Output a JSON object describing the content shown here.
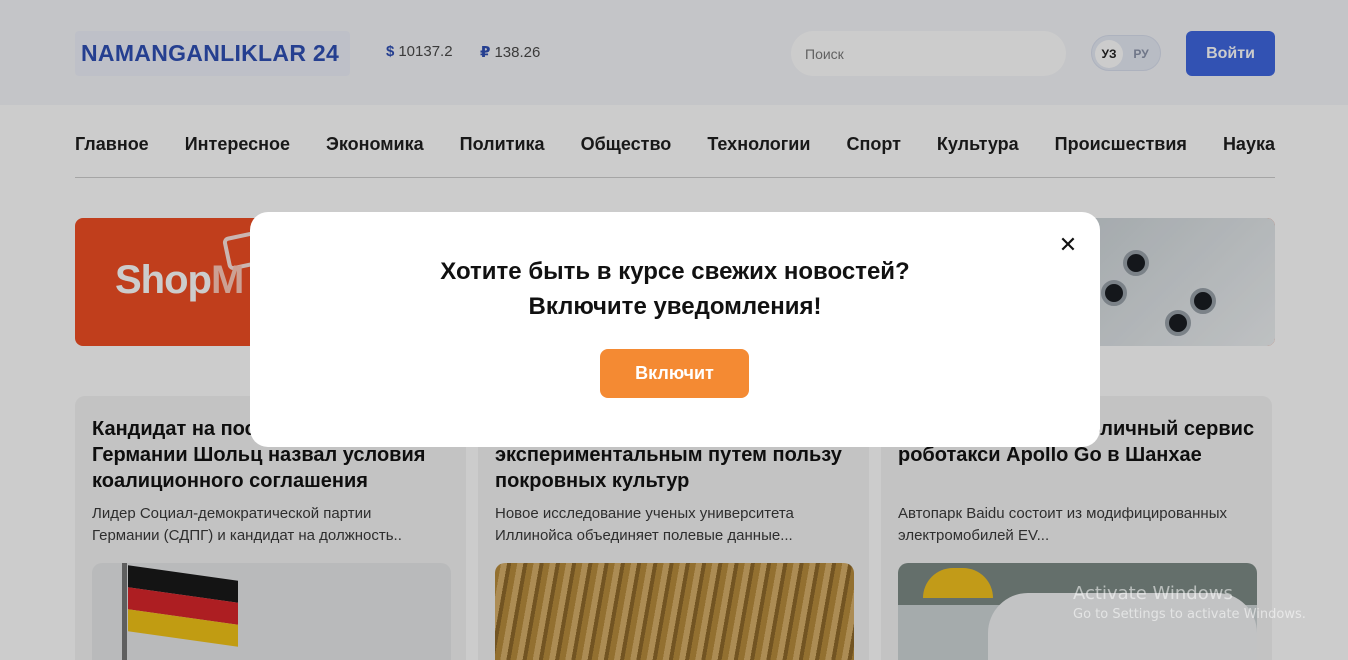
{
  "header": {
    "logo": "NAMANGANLIKLAR 24",
    "rates": [
      {
        "symbol": "$",
        "value": "10137.2"
      },
      {
        "symbol": "₽",
        "value": "138.26"
      }
    ],
    "search_placeholder": "Поиск",
    "lang": {
      "uz": "УЗ",
      "ru": "РУ"
    },
    "login_label": "Войти"
  },
  "nav": {
    "items": [
      "Главное",
      "Интересное",
      "Экономика",
      "Политика",
      "Общество",
      "Технологии",
      "Спорт",
      "Культура",
      "Происшествия",
      "Наука"
    ]
  },
  "banner": {
    "brand_text": "Shop",
    "brand_tail": "M"
  },
  "cards": [
    {
      "title": "Кандидат на пост канцлера Германии Шольц назвал условия коалиционного соглашения",
      "excerpt": "Лидер Социал-демократической партии Германии (СДПГ) и кандидат на должность.."
    },
    {
      "title": "Ученые доказали экспериментальным путем пользу покровных культур",
      "excerpt": "Новое исследование ученых университета Иллинойса объединяет полевые данные..."
    },
    {
      "title": "Baidu запустила публичный сервис роботакси Apollo Go в Шанхае",
      "excerpt": "Автопарк Baidu состоит из модифицированных электромобилей EV..."
    }
  ],
  "modal": {
    "line1": "Хотите быть в курсе свежих новостей?",
    "line2": "Включите уведомления!",
    "button_label": "Включит",
    "close_glyph": "✕"
  },
  "watermark": {
    "line1": "Activate Windows",
    "line2": "Go to Settings to activate Windows."
  },
  "colors": {
    "brand_blue": "#3f67e0",
    "accent_orange": "#f48a33",
    "banner_red": "#f04e23"
  }
}
